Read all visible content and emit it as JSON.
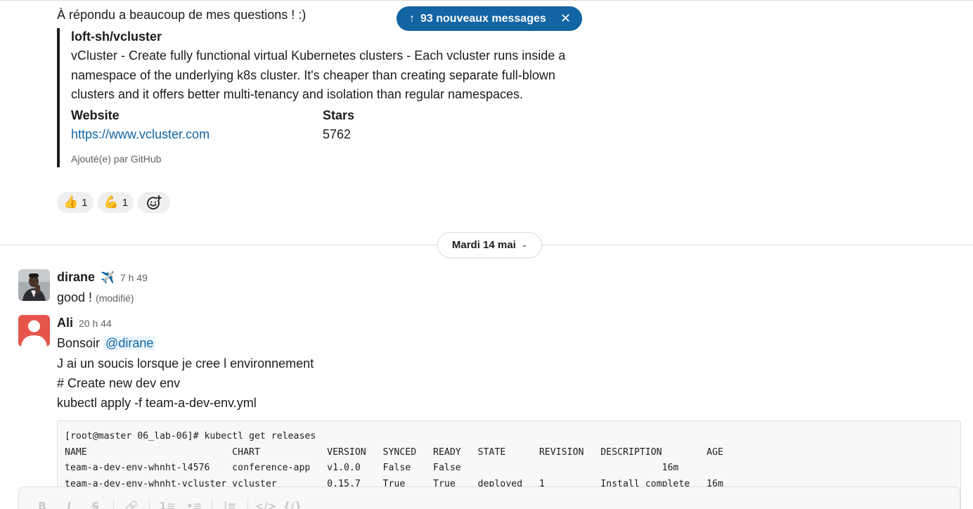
{
  "previous_message": {
    "text": "À répondu a beaucoup de mes questions ! :)",
    "attachment": {
      "title": "loft-sh/vcluster",
      "description": "vCluster - Create fully functional virtual Kubernetes clusters - Each vcluster runs inside a namespace of the underlying k8s cluster. It's cheaper than creating separate full-blown clusters and it offers better multi-tenancy and isolation than regular namespaces.",
      "fields": [
        {
          "title": "Website",
          "value": "https://www.vcluster.com"
        },
        {
          "title": "Stars",
          "value": "5762"
        }
      ],
      "footer": "Ajouté(e) par GitHub"
    },
    "reactions": [
      {
        "emoji": "👍",
        "count": "1"
      },
      {
        "emoji": "💪",
        "count": "1"
      }
    ]
  },
  "new_messages_banner": {
    "label": "93 nouveaux messages",
    "arrow": "↑",
    "close": "✕"
  },
  "date_divider": {
    "label": "Mardi 14 mai"
  },
  "messages": [
    {
      "author": "dirane",
      "status_emoji": "✈️",
      "time": "7 h 49",
      "text": "good !",
      "edited": "(modifié)"
    },
    {
      "author": "Ali",
      "time": "20 h 44",
      "greeting": "Bonsoir",
      "mention": "@dirane",
      "lines": [
        "J ai un soucis lorsque je cree l environnement",
        "# Create new dev env",
        "kubectl apply -f team-a-dev-env.yml"
      ],
      "code": "[root@master 06_lab-06]# kubectl get releases\nNAME                          CHART            VERSION   SYNCED   READY   STATE      REVISION   DESCRIPTION        AGE\nteam-a-dev-env-whnht-l4576    conference-app   v1.0.0    False    False                                    16m\nteam-a-dev-env-whnht-vcluster vcluster         0.15.7    True     True    deployed   1          Install complete   16m"
    }
  ],
  "composer": {
    "tools": [
      "B",
      "I",
      "S̶",
      "🔗",
      "1≡",
      "•≡",
      "|≡",
      "</>",
      "{/}"
    ]
  },
  "colors": {
    "accent": "#1264a3",
    "avatar_ali": "#e6554a",
    "text": "#1d1c1d",
    "muted": "#616061"
  }
}
